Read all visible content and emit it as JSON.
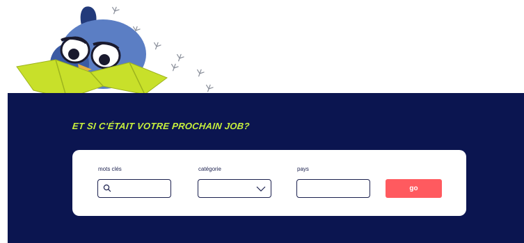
{
  "hero": {
    "headline": "ET SI C'ÉTAIT VOTRE PROCHAIN JOB?"
  },
  "search": {
    "keywords_label": "mots clés",
    "category_label": "catégorie",
    "country_label": "pays",
    "go_label": "go"
  },
  "colors": {
    "band": "#0b1550",
    "accent": "#c8f03c",
    "button": "#ff5a5f"
  },
  "icons": {
    "search": "search-icon",
    "dropdown": "chevron-down-icon"
  }
}
